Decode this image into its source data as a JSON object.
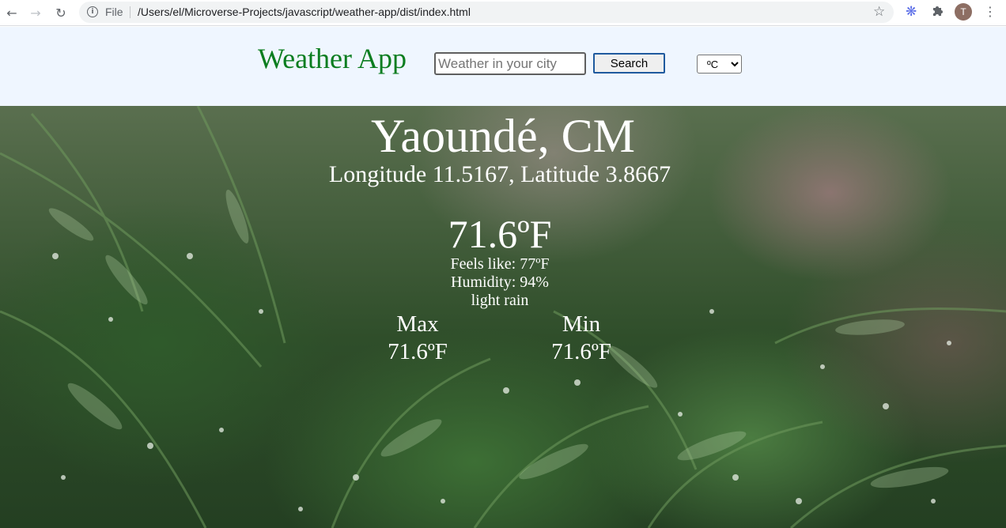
{
  "browser": {
    "file_label": "File",
    "url": "/Users/el/Microverse-Projects/javascript/weather-app/dist/index.html",
    "avatar_letter": "T"
  },
  "header": {
    "title": "Weather App",
    "search_placeholder": "Weather in your city",
    "search_button": "Search",
    "unit_selected": "ºC",
    "title_color": "#0b7d1f",
    "background": "#eff6ff"
  },
  "weather": {
    "city": "Yaoundé, CM",
    "coords": "Longitude 11.5167, Latitude 3.8667",
    "temp": "71.6ºF",
    "feels_like": "Feels like: 77ºF",
    "humidity": "Humidity: 94%",
    "description": "light rain",
    "max_label": "Max",
    "max_value": "71.6ºF",
    "min_label": "Min",
    "min_value": "71.6ºF"
  },
  "icons": [
    "back-arrow-icon",
    "forward-arrow-icon",
    "reload-icon",
    "info-icon",
    "star-icon",
    "extension-icon",
    "puzzle-icon",
    "menu-icon"
  ]
}
